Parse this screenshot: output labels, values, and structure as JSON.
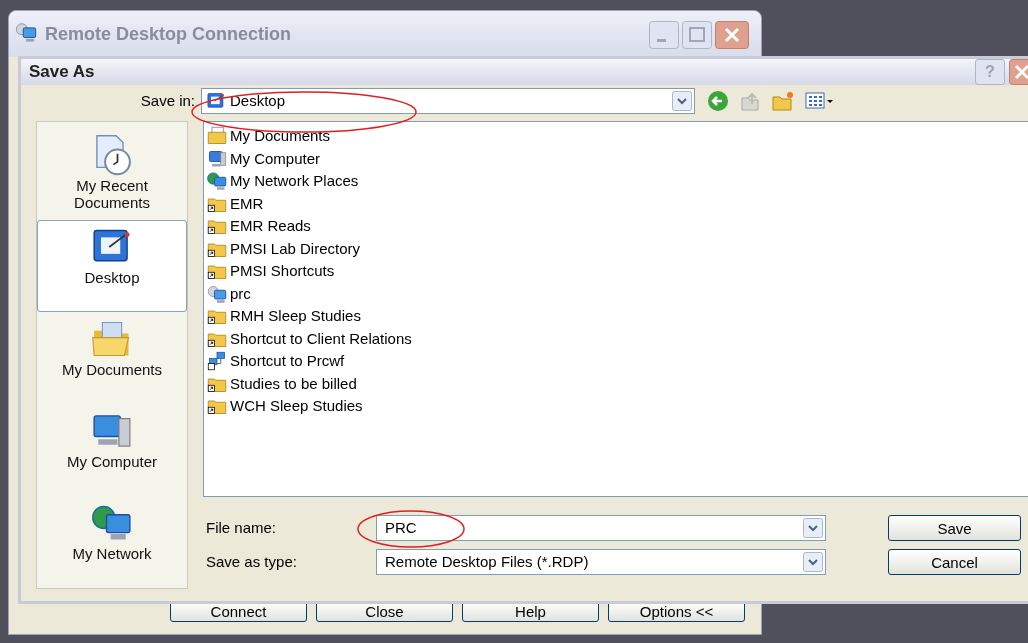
{
  "back_window": {
    "title": "Remote Desktop Connection",
    "buttons": [
      "Connect",
      "Close",
      "Help",
      "Options <<"
    ]
  },
  "dialog": {
    "title": "Save As",
    "help_button": "?",
    "save_in": {
      "label": "Save in:",
      "value": "Desktop"
    },
    "places": [
      {
        "label": "My Recent Documents",
        "kind": "recent",
        "selected": false
      },
      {
        "label": "Desktop",
        "kind": "desktop",
        "selected": true
      },
      {
        "label": "My Documents",
        "kind": "documents",
        "selected": false
      },
      {
        "label": "My Computer",
        "kind": "computer",
        "selected": false
      },
      {
        "label": "My Network",
        "kind": "network",
        "selected": false
      }
    ],
    "files": [
      {
        "name": "My Documents",
        "kind": "documents"
      },
      {
        "name": "My Computer",
        "kind": "computer"
      },
      {
        "name": "My Network Places",
        "kind": "network"
      },
      {
        "name": "EMR",
        "kind": "folder-shortcut"
      },
      {
        "name": "EMR Reads",
        "kind": "folder-shortcut"
      },
      {
        "name": "PMSI Lab Directory",
        "kind": "folder-shortcut"
      },
      {
        "name": "PMSI Shortcuts",
        "kind": "folder-shortcut"
      },
      {
        "name": "prc",
        "kind": "rdp"
      },
      {
        "name": "RMH Sleep Studies",
        "kind": "folder-shortcut"
      },
      {
        "name": "Shortcut to Client Relations",
        "kind": "folder-shortcut"
      },
      {
        "name": "Shortcut to Prcwf",
        "kind": "network-shortcut"
      },
      {
        "name": "Studies to be billed",
        "kind": "folder-shortcut"
      },
      {
        "name": "WCH Sleep Studies",
        "kind": "folder-shortcut"
      }
    ],
    "file_name": {
      "label": "File name:",
      "value": "PRC"
    },
    "save_as_type": {
      "label": "Save as type:",
      "value": "Remote Desktop Files (*.RDP)"
    },
    "buttons": [
      "Save",
      "Cancel"
    ]
  }
}
